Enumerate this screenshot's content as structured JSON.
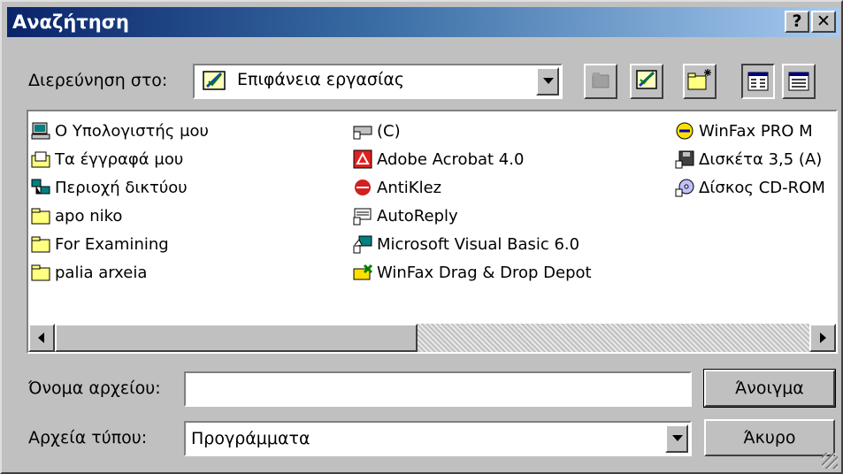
{
  "dialog": {
    "title": "Αναζήτηση",
    "help_label": "?",
    "close_label": "✕"
  },
  "look_in": {
    "label": "Διερεύνηση στο:",
    "value": "Επιφάνεια εργασίας"
  },
  "toolbar": {
    "icons": [
      "up-folder-icon",
      "desktop-icon",
      "new-folder-icon",
      "list-view-icon",
      "details-view-icon"
    ]
  },
  "files": {
    "col1": [
      {
        "label": "Ο Υπολογιστής μου",
        "icon": "my-computer-icon"
      },
      {
        "label": "Τα έγγραφά μου",
        "icon": "my-documents-icon"
      },
      {
        "label": "Περιοχή δικτύου",
        "icon": "network-icon"
      },
      {
        "label": "apo niko",
        "icon": "folder-icon"
      },
      {
        "label": "For Examining",
        "icon": "folder-icon"
      },
      {
        "label": "palia arxeia",
        "icon": "folder-icon"
      }
    ],
    "col2": [
      {
        "label": "(C)",
        "icon": "drive-shortcut-icon"
      },
      {
        "label": "Adobe Acrobat 4.0",
        "icon": "acrobat-icon"
      },
      {
        "label": "AntiKlez",
        "icon": "antiklez-icon"
      },
      {
        "label": "AutoReply",
        "icon": "autoreply-icon"
      },
      {
        "label": "Microsoft Visual Basic 6.0",
        "icon": "visual-basic-icon"
      },
      {
        "label": "WinFax Drag & Drop Depot",
        "icon": "winfax-depot-icon"
      }
    ],
    "col3": [
      {
        "label": "WinFax PRO M",
        "icon": "winfax-icon"
      },
      {
        "label": "Δισκέτα 3,5 (A)",
        "icon": "floppy-icon"
      },
      {
        "label": "Δίσκος CD-ROM",
        "icon": "cdrom-icon"
      }
    ]
  },
  "filename": {
    "label": "Όνομα αρχείου:",
    "value": ""
  },
  "filetype": {
    "label": "Αρχεία τύπου:",
    "value": "Προγράμματα"
  },
  "buttons": {
    "open": "Άνοιγμα",
    "cancel": "Άκυρο"
  }
}
